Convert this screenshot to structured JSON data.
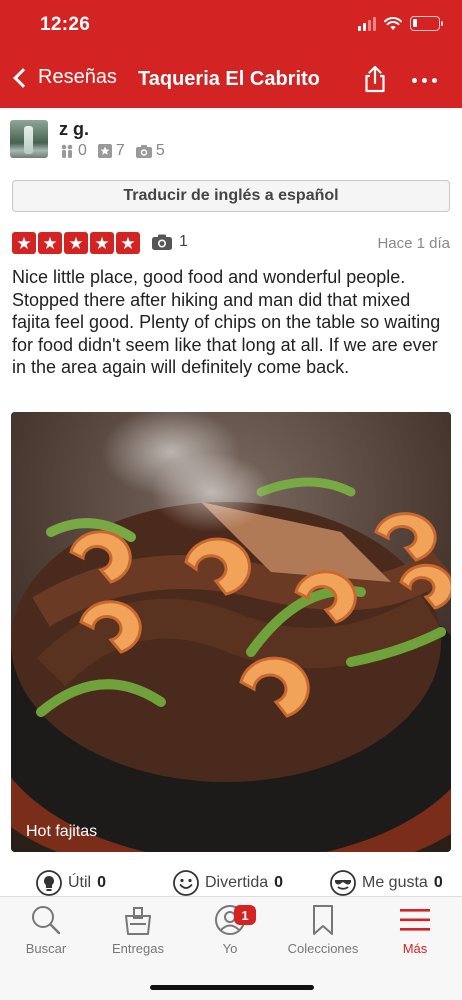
{
  "status_bar": {
    "time": "12:26"
  },
  "nav": {
    "back_label": "Reseñas",
    "title": "Taqueria El Cabrito",
    "share_icon": "share-icon",
    "more_icon": "more-dots-icon"
  },
  "user": {
    "name": "z g.",
    "friends": "0",
    "reviews": "7",
    "photos": "5"
  },
  "translate_button": "Traducir de inglés a español",
  "review": {
    "rating": 5,
    "photo_count": "1",
    "date": "Hace 1 día",
    "text": "Nice little place, good food and wonderful people. Stopped there after hiking and man did that mixed fajita feel good. Plenty of chips on the table so waiting for food didn't seem like that  long at all. If we are ever in the area again will definitely come back.",
    "photo_caption": "Hot fajitas"
  },
  "reactions": {
    "useful_label": "Útil",
    "useful_count": "0",
    "funny_label": "Divertida",
    "funny_count": "0",
    "cool_label": "Me gusta",
    "cool_count": "0"
  },
  "tabs": [
    {
      "label": "Buscar",
      "icon": "search-icon"
    },
    {
      "label": "Entregas",
      "icon": "delivery-bag-icon"
    },
    {
      "label": "Yo",
      "icon": "profile-icon",
      "badge": "1"
    },
    {
      "label": "Colecciones",
      "icon": "bookmark-icon"
    },
    {
      "label": "Más",
      "icon": "menu-icon",
      "active": true
    }
  ],
  "colors": {
    "brand": "#d32323",
    "tab_active": "#d32323",
    "text": "#222222",
    "muted": "#888888"
  }
}
